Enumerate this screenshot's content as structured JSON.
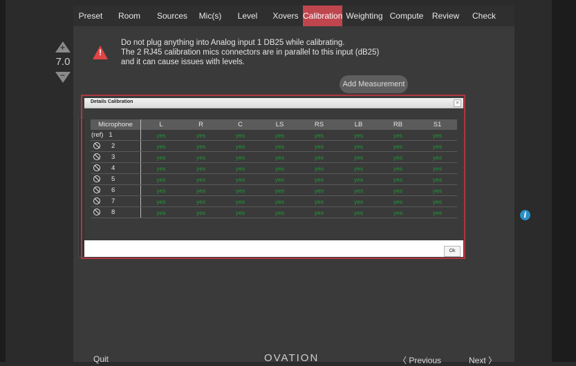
{
  "tabs": [
    "Preset",
    "Room",
    "Sources",
    "Mic(s)",
    "Level",
    "Xovers",
    "Calibration",
    "Weighting",
    "Compute",
    "Review",
    "Check"
  ],
  "active_tab": "Calibration",
  "zoom": {
    "up_symbol": "+",
    "value": "7.0",
    "down_symbol": "−"
  },
  "warning": {
    "icon": "warning-icon",
    "lines": [
      "Do not plug anything into Analog input 1 DB25 while calibrating.",
      "The 2 RJ45 calibration mics connectors are in parallel to this input (dB25)",
      "and it can cause issues with levels."
    ]
  },
  "add_measurement_label": "Add Measurement",
  "info_icon_symbol": "i",
  "dialog": {
    "title": "Details Calibration",
    "close_symbol": "×",
    "ok_label": "Ok",
    "columns": [
      "Microphone",
      "L",
      "R",
      "C",
      "LS",
      "RS",
      "LB",
      "RB",
      "S1"
    ],
    "rows": [
      {
        "prefix": "(ref)",
        "icon": "",
        "num": "1",
        "values": [
          "yes",
          "yes",
          "yes",
          "yes",
          "yes",
          "yes",
          "yes",
          "yes"
        ]
      },
      {
        "prefix": "",
        "icon": "disabled-icon",
        "num": "2",
        "values": [
          "yes",
          "yes",
          "yes",
          "yes",
          "yes",
          "yes",
          "yes",
          "yes"
        ]
      },
      {
        "prefix": "",
        "icon": "disabled-icon",
        "num": "3",
        "values": [
          "yes",
          "yes",
          "yes",
          "yes",
          "yes",
          "yes",
          "yes",
          "yes"
        ]
      },
      {
        "prefix": "",
        "icon": "disabled-icon",
        "num": "4",
        "values": [
          "yes",
          "yes",
          "yes",
          "yes",
          "yes",
          "yes",
          "yes",
          "yes"
        ]
      },
      {
        "prefix": "",
        "icon": "disabled-icon",
        "num": "5",
        "values": [
          "yes",
          "yes",
          "yes",
          "yes",
          "yes",
          "yes",
          "yes",
          "yes"
        ]
      },
      {
        "prefix": "",
        "icon": "disabled-icon",
        "num": "6",
        "values": [
          "yes",
          "yes",
          "yes",
          "yes",
          "yes",
          "yes",
          "yes",
          "yes"
        ]
      },
      {
        "prefix": "",
        "icon": "disabled-icon",
        "num": "7",
        "values": [
          "yes",
          "yes",
          "yes",
          "yes",
          "yes",
          "yes",
          "yes",
          "yes"
        ]
      },
      {
        "prefix": "",
        "icon": "disabled-icon",
        "num": "8",
        "values": [
          "yes",
          "yes",
          "yes",
          "yes",
          "yes",
          "yes",
          "yes",
          "yes"
        ]
      }
    ]
  },
  "footer": {
    "quit": "Quit",
    "logo": "OVATION",
    "previous": "〈 Previous",
    "next": "Next 〉"
  },
  "colors": {
    "accent": "#c0464e",
    "yes": "#1e9a35",
    "info": "#2a8fc8",
    "warning": "#e04545"
  }
}
